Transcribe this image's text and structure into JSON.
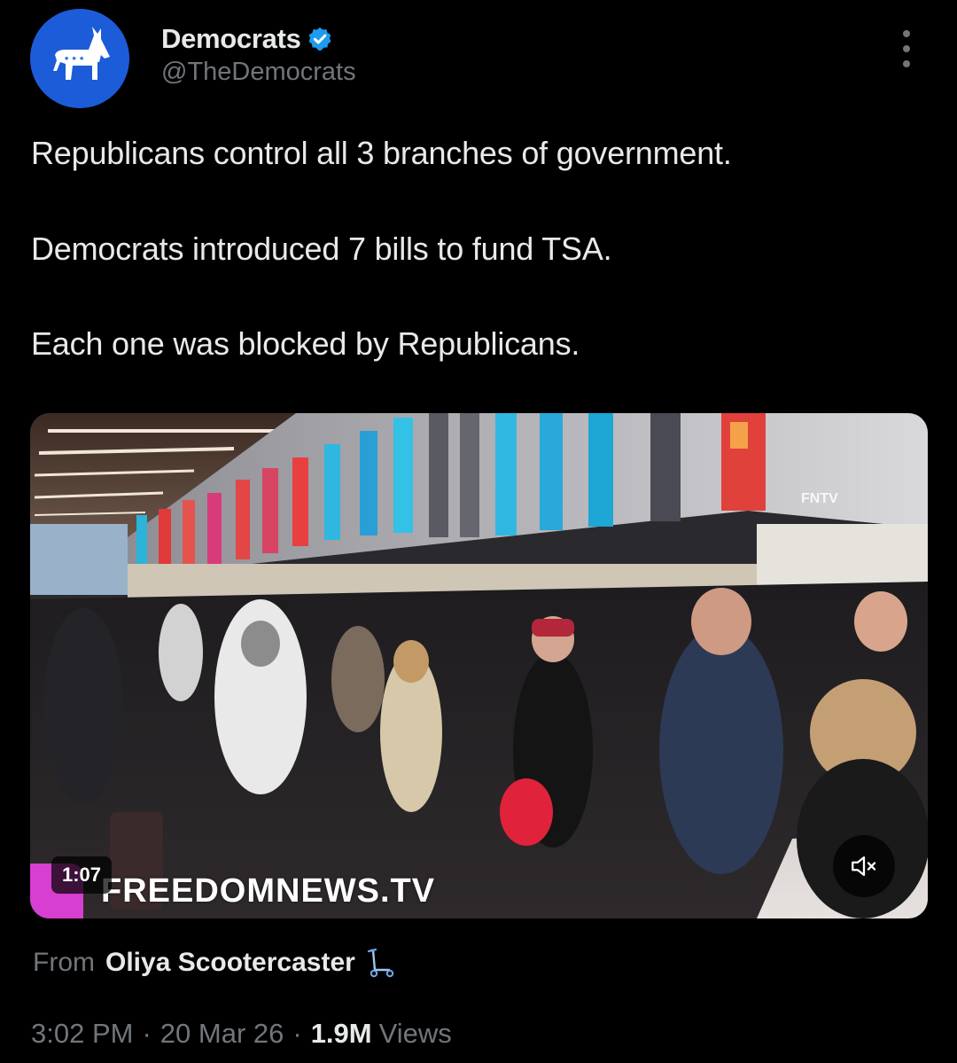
{
  "author": {
    "display_name": "Democrats",
    "handle": "@TheDemocrats",
    "avatar_icon": "donkey-logo-icon",
    "verified": true,
    "avatar_color": "#1c5cd8",
    "verified_color": "#1d9bf0"
  },
  "tweet": {
    "lines": [
      "Republicans control all 3 branches of government.",
      "Democrats introduced 7 bills to fund TSA.",
      "Each one was blocked by Republicans."
    ]
  },
  "media": {
    "duration": "1:07",
    "watermark": "FREEDOMNEWS.TV",
    "corner_tag": "FNTV",
    "mute_icon": "speaker-muted-icon"
  },
  "source": {
    "prefix": "From",
    "name": "Oliya Scootercaster",
    "emoji_icon": "scooter-icon"
  },
  "meta": {
    "time": "3:02 PM",
    "date": "20 Mar 26",
    "views_count": "1.9M",
    "views_label": "Views",
    "separator": "·"
  },
  "colors": {
    "background": "#000000",
    "primary_text": "#e7e9ea",
    "secondary_text": "#71767b"
  }
}
